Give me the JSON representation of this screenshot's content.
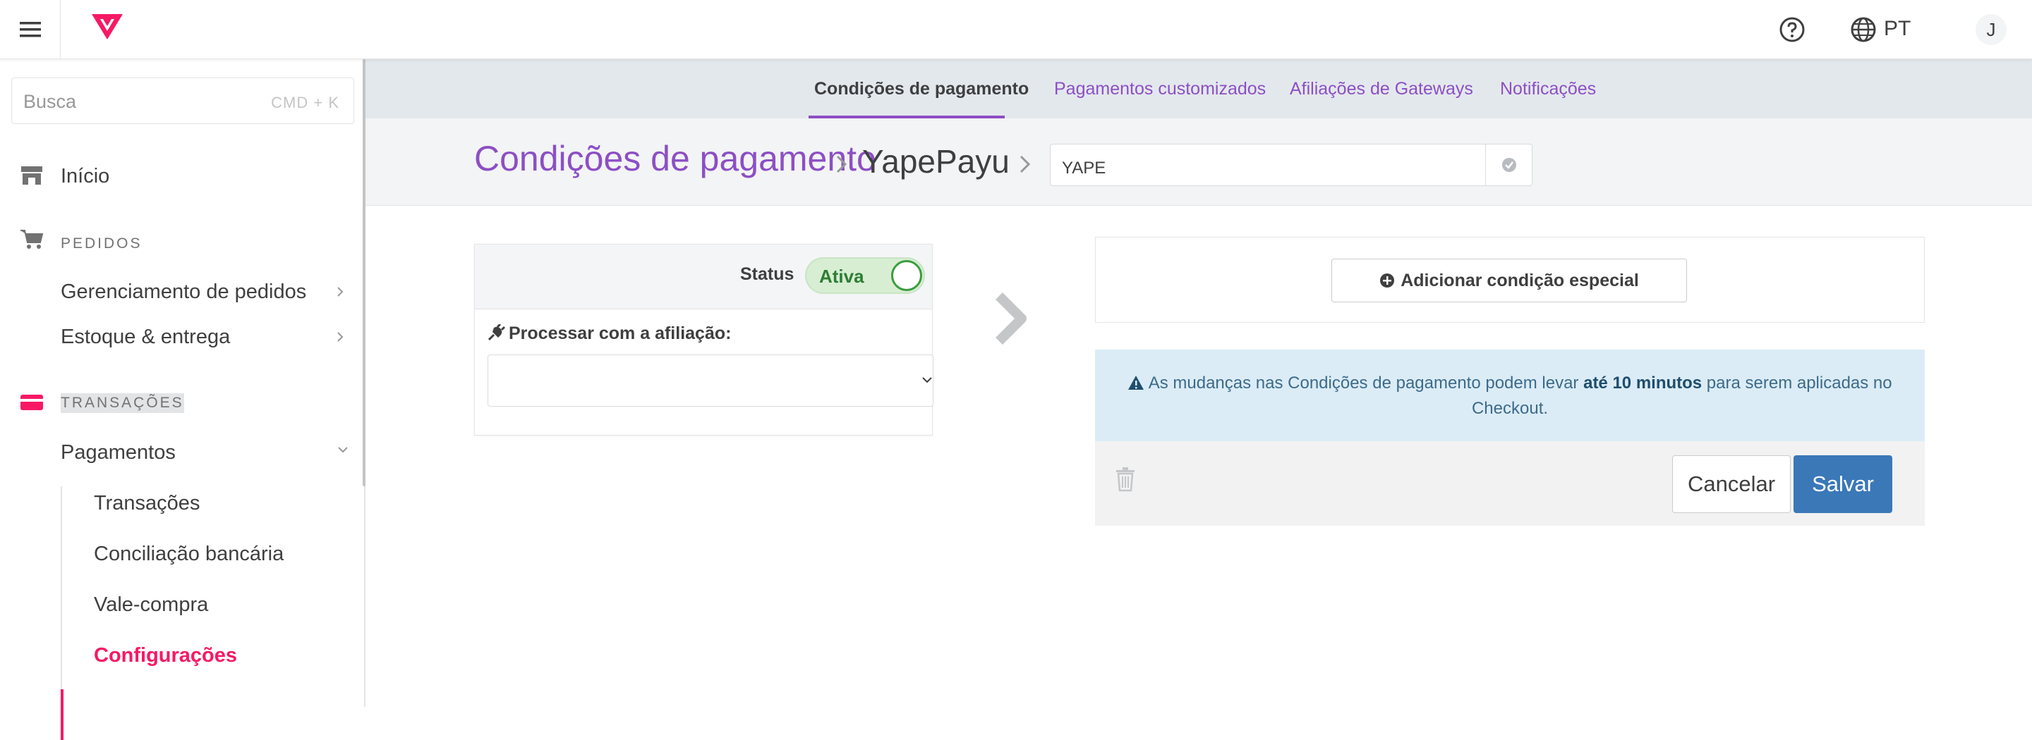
{
  "topbar": {
    "language": "PT",
    "avatar_initial": "J"
  },
  "sidebar": {
    "search_placeholder": "Busca",
    "search_shortcut": "CMD + K",
    "home": "Início",
    "section_orders": "PEDIDOS",
    "orders_items": [
      "Gerenciamento de pedidos",
      "Estoque & entrega"
    ],
    "section_transactions": "TRANSAÇÕES",
    "payments": "Pagamentos",
    "payments_items": [
      "Transações",
      "Conciliação bancária",
      "Vale-compra",
      "Configurações"
    ]
  },
  "tabs": [
    "Condições de pagamento",
    "Pagamentos customizados",
    "Afiliações de Gateways",
    "Notificações"
  ],
  "breadcrumb": {
    "root": "Condições de pagamento",
    "current": "YapePayu",
    "name_value": "YAPE"
  },
  "condition": {
    "status_label": "Status",
    "status_value": "Ativa",
    "affiliation_label": "Processar com a afiliação:",
    "affiliation_value": ""
  },
  "special": {
    "add_label": "Adicionar condição especial"
  },
  "notice": {
    "part1": "As mudanças nas Condições de pagamento podem levar ",
    "bold": "até 10 minutos",
    "part2": " para serem aplicadas no Checkout."
  },
  "actions": {
    "cancel": "Cancelar",
    "save": "Salvar"
  },
  "colors": {
    "brand": "#f71963",
    "purple": "#8d4fc4",
    "primary": "#3a78b8",
    "success": "#3a9d3f"
  }
}
